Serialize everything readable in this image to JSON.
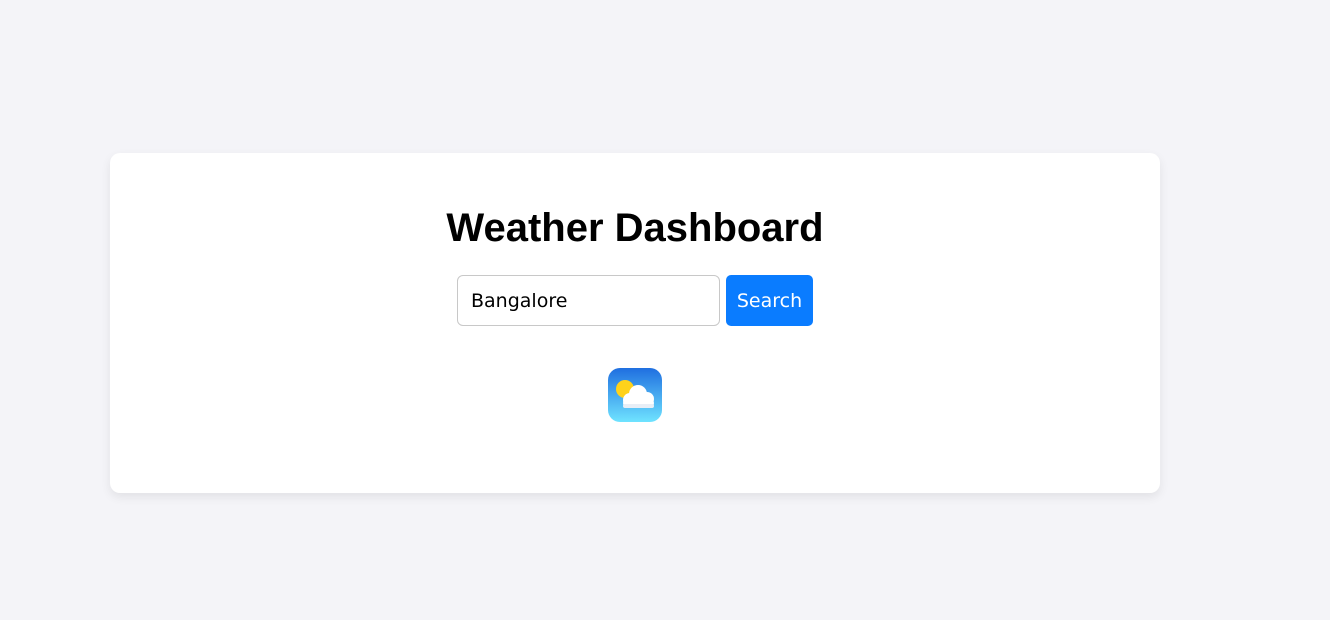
{
  "app": {
    "title": "Weather Dashboard"
  },
  "search": {
    "value": "Bangalore",
    "placeholder": "",
    "button_label": "Search"
  },
  "weather": {
    "icon": "partly-cloudy-icon"
  },
  "colors": {
    "background": "#f4f4f8",
    "card": "#ffffff",
    "accent": "#0a7cff"
  }
}
